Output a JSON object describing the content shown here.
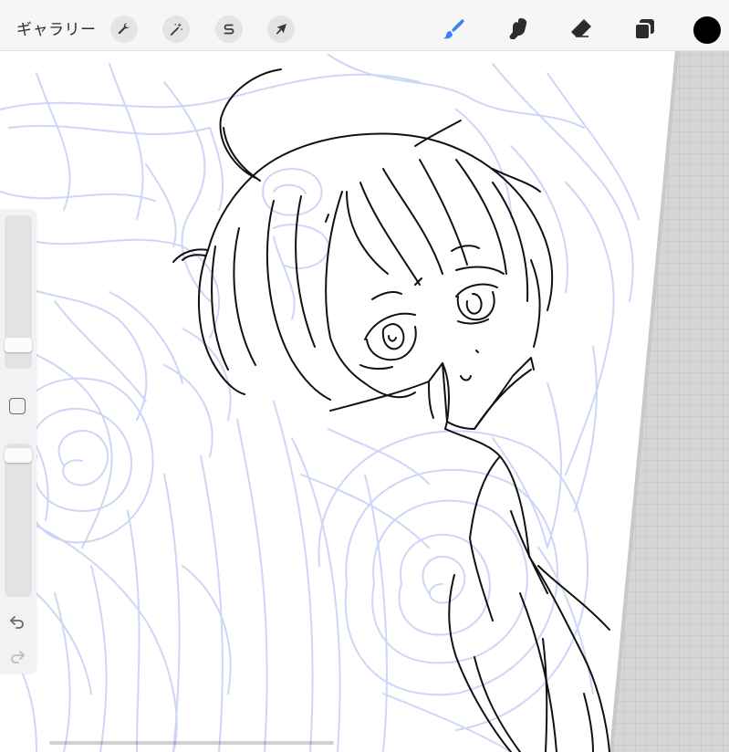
{
  "toolbar": {
    "gallery_label": "ギャラリー",
    "actions_icon": "wrench-icon",
    "adjustments_icon": "magic-wand-icon",
    "selection_icon": "selection-s-icon",
    "transform_icon": "arrow-cursor-icon",
    "brush_icon": "brush-icon",
    "smudge_icon": "smudge-icon",
    "eraser_icon": "eraser-icon",
    "layers_icon": "layers-icon",
    "current_color": "#000000",
    "active_tool_color": "#3b82f6"
  },
  "sidebar": {
    "brush_size": 0.12,
    "opacity": 0.97,
    "modifier_icon": "square-modifier-icon",
    "undo_icon": "undo-icon",
    "redo_icon": "redo-icon"
  },
  "canvas": {
    "background_color": "#ffffff",
    "sketch_color": "#c8d2f5",
    "line_color": "#111111"
  }
}
